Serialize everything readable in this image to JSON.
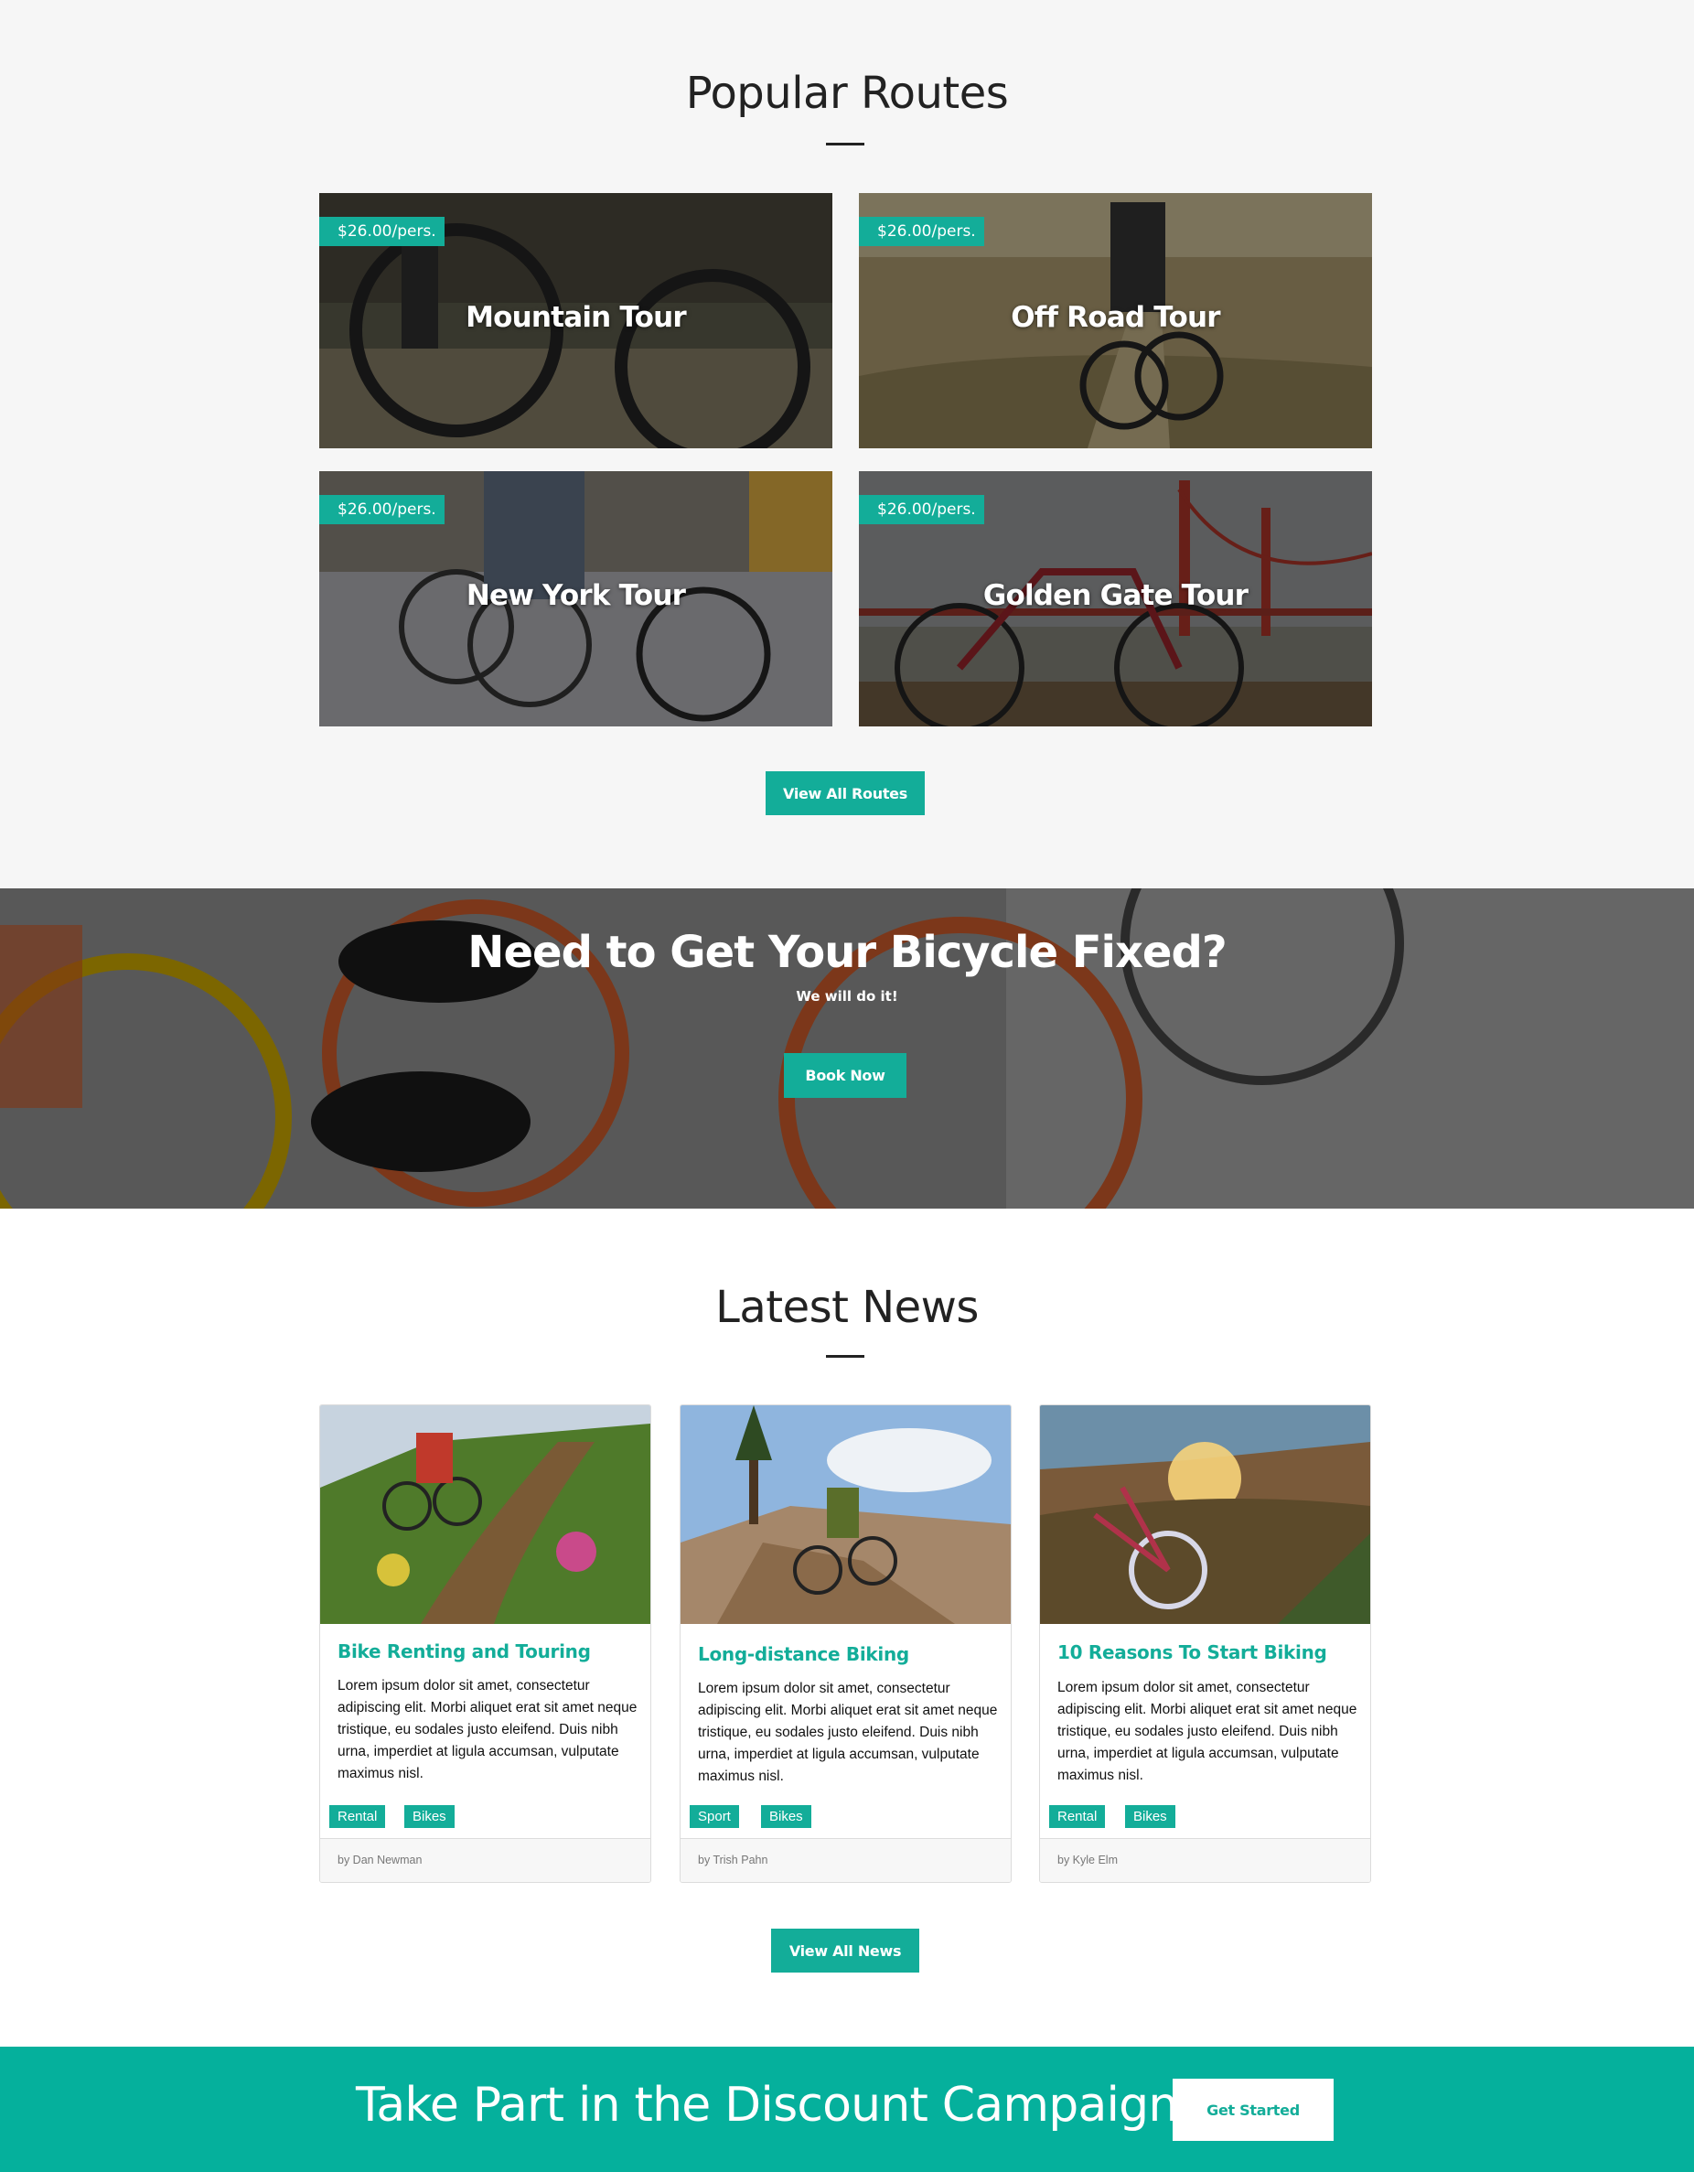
{
  "routes": {
    "title": "Popular Routes",
    "cards": [
      {
        "price": "$26.00/pers.",
        "name": "Mountain Tour"
      },
      {
        "price": "$26.00/pers.",
        "name": "Off Road Tour"
      },
      {
        "price": "$26.00/pers.",
        "name": "New York Tour"
      },
      {
        "price": "$26.00/pers.",
        "name": "Golden Gate Tour"
      }
    ],
    "view_all_label": "View All Routes"
  },
  "repair": {
    "title": "Need to Get Your Bicycle Fixed?",
    "subtitle": "We will do it!",
    "button_label": "Book Now"
  },
  "news": {
    "title": "Latest News",
    "cards": [
      {
        "title": "Bike Renting and Touring",
        "body": "Lorem ipsum dolor sit amet, consectetur adipiscing elit. Morbi aliquet erat sit amet neque tristique, eu sodales justo eleifend. Duis nibh urna, imperdiet at ligula accumsan, vulputate maximus nisl.",
        "tags": [
          "Rental",
          "Bikes"
        ],
        "author": "by Dan Newman"
      },
      {
        "title": "Long-distance Biking",
        "body": "Lorem ipsum dolor sit amet, consectetur adipiscing elit. Morbi aliquet erat sit amet neque tristique, eu sodales justo eleifend. Duis nibh urna, imperdiet at ligula accumsan, vulputate maximus nisl.",
        "tags": [
          "Sport",
          "Bikes"
        ],
        "author": "by Trish Pahn"
      },
      {
        "title": "10 Reasons To Start Biking",
        "body": "Lorem ipsum dolor sit amet, consectetur adipiscing elit. Morbi aliquet erat sit amet neque tristique, eu sodales justo eleifend. Duis nibh urna, imperdiet at ligula accumsan, vulputate maximus nisl.",
        "tags": [
          "Rental",
          "Bikes"
        ],
        "author": "by Kyle Elm"
      }
    ],
    "view_all_label": "View All News"
  },
  "campaign": {
    "text": "Take Part in the Discount Campaign",
    "button_label": "Get Started"
  },
  "colors": {
    "accent": "#13ad99",
    "campaign_bg": "#05b09c",
    "section_bg": "#f6f6f6"
  }
}
